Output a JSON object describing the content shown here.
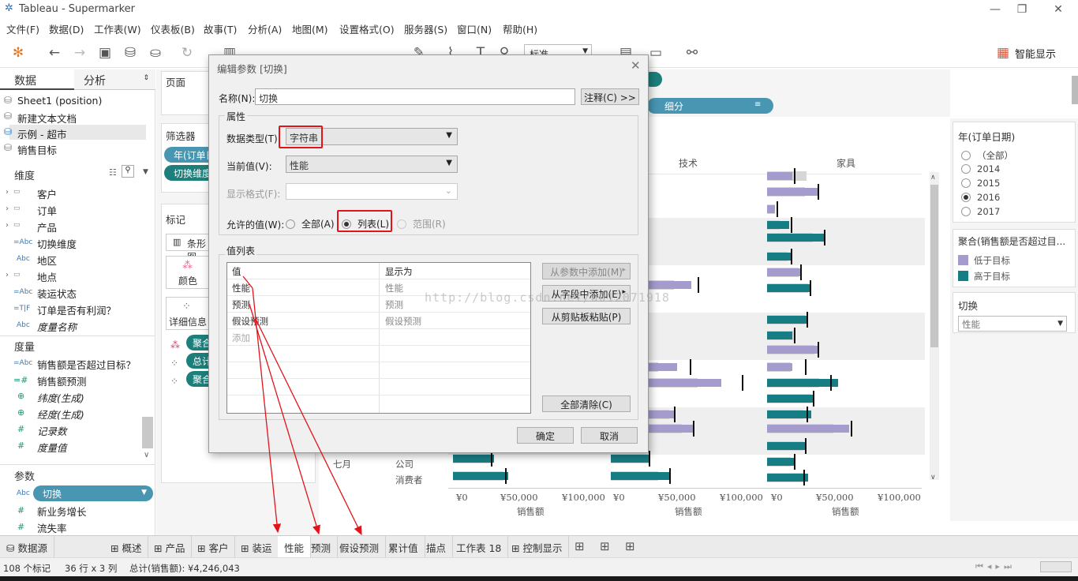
{
  "app": {
    "title": "Tableau - Supermarker"
  },
  "menu": [
    "文件(F)",
    "数据(D)",
    "工作表(W)",
    "仪表板(B)",
    "故事(T)",
    "分析(A)",
    "地图(M)",
    "设置格式(O)",
    "服务器(S)",
    "窗口(N)",
    "帮助(H)"
  ],
  "toolbar": {
    "fit_select": "标准",
    "show_me": "智能显示"
  },
  "left": {
    "tabs": {
      "data": "数据",
      "analysis": "分析"
    },
    "datasources": [
      "Sheet1 (position)",
      "新建文本文档",
      "示例 - 超市",
      "销售目标"
    ],
    "dimensions_header": "维度",
    "dimensions": [
      {
        "name": "客户",
        "icon": "folder"
      },
      {
        "name": "订单",
        "icon": "folder"
      },
      {
        "name": "产品",
        "icon": "folder"
      },
      {
        "name": "切换维度",
        "icon": "=Abc"
      },
      {
        "name": "地区",
        "icon": "Abc"
      },
      {
        "name": "地点",
        "icon": "folder"
      },
      {
        "name": "装运状态",
        "icon": "=Abc"
      },
      {
        "name": "订单是否有利润？",
        "icon": "=T|F"
      },
      {
        "name": "度量名称",
        "icon": "Abc"
      }
    ],
    "measures_header": "度量",
    "measures": [
      {
        "name": "销售额是否超过目标？",
        "icon": "=Abc"
      },
      {
        "name": "销售额预测",
        "icon": "=#"
      },
      {
        "name": "纬度(生成)",
        "icon": "globe"
      },
      {
        "name": "经度(生成)",
        "icon": "globe"
      },
      {
        "name": "记录数",
        "icon": "#"
      },
      {
        "name": "度量值",
        "icon": "#"
      }
    ],
    "params_header": "参数",
    "params": [
      {
        "name": "切换",
        "icon": "Abc"
      },
      {
        "name": "新业务增长",
        "icon": "#"
      },
      {
        "name": "流失率",
        "icon": "#"
      }
    ]
  },
  "shelves": {
    "pages": "页面",
    "filters": "筛选器",
    "filter_pills": [
      "年(订单日",
      "切换维度"
    ],
    "marks": "标记",
    "marks_type": "条形图",
    "color": "颜色",
    "detail": "详细信息",
    "mark_pills": [
      "聚合",
      "总计",
      "聚合"
    ],
    "rows_pill": "细分"
  },
  "viz": {
    "col_heads": [
      "技术",
      "家具"
    ],
    "row_labels": {
      "month": "七月",
      "seg1": "公司",
      "seg2": "消费者"
    },
    "axis_ticks": [
      "¥0",
      "¥50,000",
      "¥100,000"
    ],
    "axis_title": "销售额"
  },
  "right": {
    "year_filter": {
      "title": "年(订单日期)",
      "options": [
        "（全部）",
        "2014",
        "2015",
        "2016",
        "2017"
      ],
      "selected": "2016"
    },
    "legend": {
      "title": "聚合(销售额是否超过目...",
      "items": [
        "低于目标",
        "高于目标"
      ]
    },
    "switch": {
      "title": "切换",
      "value": "性能"
    }
  },
  "sheets": [
    "数据源",
    "概述",
    "产品",
    "客户",
    "装运",
    "性能",
    "预测",
    "假设预测",
    "累计值",
    "描点",
    "工作表 18",
    "控制显示"
  ],
  "active_sheet": "性能",
  "status": {
    "marks": "108 个标记",
    "rows_cols": "36 行 x 3 列",
    "sum": "总计(销售额): ¥4,246,043"
  },
  "dialog": {
    "title": "编辑参数 [切换]",
    "name_label": "名称(N):",
    "name_value": "切换",
    "comment_btn": "注释(C) >>",
    "props_title": "属性",
    "dtype_label": "数据类型(T):",
    "dtype_value": "字符串",
    "current_label": "当前值(V):",
    "current_value": "性能",
    "format_label": "显示格式(F):",
    "allowed_label": "允许的值(W):",
    "allowed_all": "全部(A)",
    "allowed_list": "列表(L)",
    "allowed_range": "范围(R)",
    "list_title": "值列表",
    "col_value": "值",
    "col_display": "显示为",
    "rows": [
      {
        "value": "性能",
        "display": "性能"
      },
      {
        "value": "预测",
        "display": "预测"
      },
      {
        "value": "假设预测",
        "display": "假设预测"
      }
    ],
    "add_placeholder": "添加",
    "btn_from_param": "从参数中添加(M)",
    "btn_from_field": "从字段中添加(E)",
    "btn_paste": "从剪贴板粘贴(P)",
    "btn_clear": "全部清除(C)",
    "btn_ok": "确定",
    "btn_cancel": "取消"
  },
  "watermark": "http://blog.csdn.net/u012071918"
}
